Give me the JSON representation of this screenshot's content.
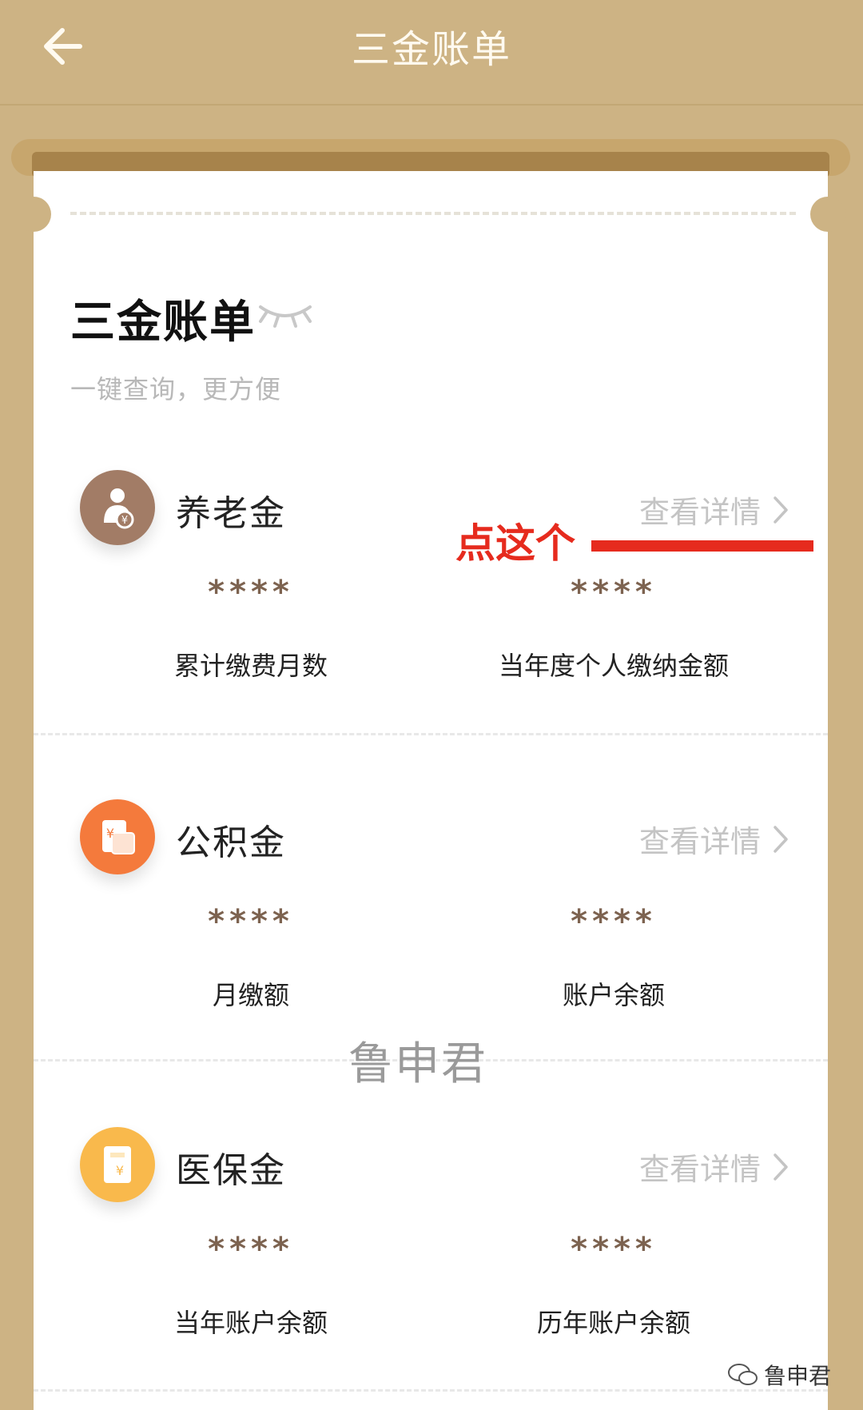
{
  "nav": {
    "title": "三金账单",
    "back_icon": "arrow-left-icon"
  },
  "card": {
    "title": "三金账单",
    "eye_icon": "eye-closed-icon",
    "subtitle": "一键查询，更方便"
  },
  "annotation": {
    "text": "点这个",
    "color": "#e62b1e"
  },
  "sections": [
    {
      "title": "养老金",
      "icon": "pension-icon",
      "detail_label": "查看详情",
      "metrics": [
        {
          "value": "****",
          "label": "累计缴费月数"
        },
        {
          "value": "****",
          "label": "当年度个人缴纳金额"
        }
      ]
    },
    {
      "title": "公积金",
      "icon": "housing-fund-icon",
      "detail_label": "查看详情",
      "metrics": [
        {
          "value": "****",
          "label": "月缴额"
        },
        {
          "value": "****",
          "label": "账户余额"
        }
      ]
    },
    {
      "title": "医保金",
      "icon": "medical-insurance-icon",
      "detail_label": "查看详情",
      "metrics": [
        {
          "value": "****",
          "label": "当年账户余额"
        },
        {
          "value": "****",
          "label": "历年账户余额"
        }
      ]
    }
  ],
  "watermark": {
    "center_text": "鲁申君",
    "corner_text": "鲁申君"
  },
  "colors": {
    "header_bg": "#cdb384",
    "mask_text": "#7d6350",
    "pension_badge": "#a27c66",
    "fund_badge": "#f47a3c",
    "medical_badge": "#f9b94c"
  }
}
